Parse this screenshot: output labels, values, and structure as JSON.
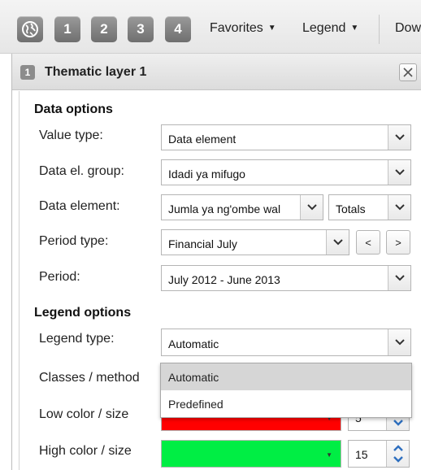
{
  "toolbar": {
    "buttons": [
      "1",
      "2",
      "3",
      "4"
    ],
    "favorites_label": "Favorites",
    "legend_label": "Legend",
    "truncated_label": "Dow"
  },
  "panel": {
    "badge": "1",
    "title": "Thematic layer 1"
  },
  "data_options": {
    "title": "Data options",
    "value_type_label": "Value type:",
    "value_type": "Data element",
    "data_el_group_label": "Data el. group:",
    "data_el_group": "Idadi ya mifugo",
    "data_element_label": "Data element:",
    "data_element": "Jumla ya ng'ombe wal",
    "data_element_detail": "Totals",
    "period_type_label": "Period type:",
    "period_type": "Financial July",
    "prev_label": "<",
    "next_label": ">",
    "period_label": "Period:",
    "period": "July 2012 - June 2013"
  },
  "legend_options": {
    "title": "Legend options",
    "legend_type_label": "Legend type:",
    "legend_type": "Automatic",
    "classes_label": "Classes / method",
    "low_label": "Low color / size",
    "low_color": "#ff0000",
    "low_size": "5",
    "high_label": "High color / size",
    "high_color": "#00ee44",
    "high_size": "15"
  },
  "legend_type_dropdown": {
    "options": [
      "Automatic",
      "Predefined"
    ],
    "selected": "Automatic"
  }
}
